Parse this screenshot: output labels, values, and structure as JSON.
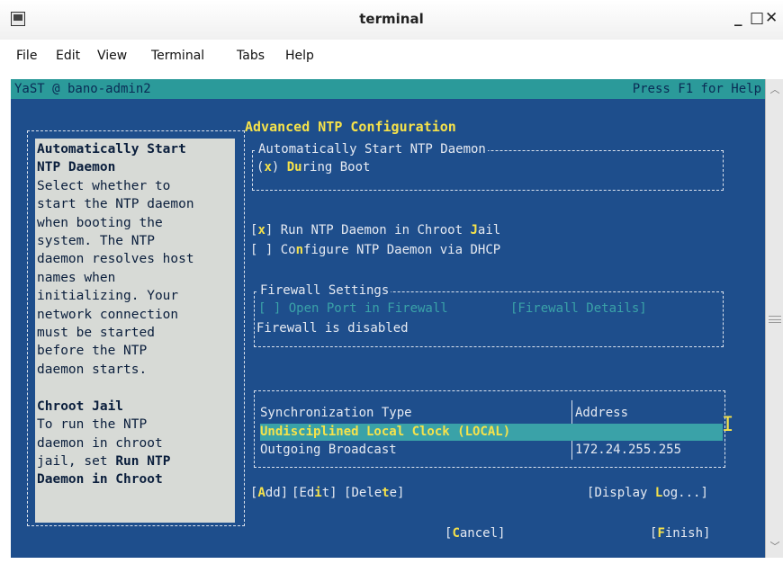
{
  "window": {
    "title": "terminal",
    "min_glyph": "_",
    "max_glyph": "□",
    "close_glyph": "✕"
  },
  "menu": {
    "file": "File",
    "edit": "Edit",
    "view": "View",
    "terminal": "Terminal",
    "tabs": "Tabs",
    "help": "Help"
  },
  "yast": {
    "header_left": "YaST @ bano-admin2",
    "header_right": "Press F1 for Help",
    "help_text": {
      "heading1": "Automatically Start",
      "heading1b": "NTP Daemon",
      "para1": "Select whether to\nstart the NTP daemon\nwhen booting the\nsystem. The NTP\ndaemon resolves host\nnames when\ninitializing. Your\nnetwork connection\nmust be started\nbefore the NTP\ndaemon starts.",
      "heading2": "Chroot Jail",
      "para2a": "To run the NTP\ndaemon in chroot\njail, set ",
      "para2b": "Run NTP",
      "para2c": "Daemon in Chroot"
    },
    "panel_title": "Advanced NTP Configuration",
    "auto_start": {
      "frame_title": "Automatically Start NTP Daemon",
      "radio_mark": "x",
      "radio_label_hot": "Du",
      "radio_label_rest": "ring Boot"
    },
    "chroot": {
      "mark": "x",
      "label_pre": "Run NTP Daemon in Chroot ",
      "label_hot": "J",
      "label_post": "ail"
    },
    "dhcp": {
      "mark": " ",
      "label_pre": "Co",
      "label_hot": "n",
      "label_post": "figure NTP Daemon via DHCP"
    },
    "firewall": {
      "frame_title": "Firewall Settings",
      "open_port_label": "[ ] Open Port in Firewall",
      "details_label": "[Firewall Details]",
      "status": "Firewall is disabled"
    },
    "sync_table": {
      "columns": [
        "Synchronization Type",
        "Address"
      ],
      "rows": [
        [
          "Undisciplined Local Clock (LOCAL)",
          ""
        ],
        [
          "Outgoing Broadcast",
          "172.24.255.255"
        ]
      ]
    },
    "buttons": {
      "add_hot": "A",
      "add_rest": "dd",
      "edit_pre": "Ed",
      "edit_hot": "i",
      "edit_post": "t",
      "delete_pre": "Dele",
      "delete_hot": "t",
      "delete_post": "e",
      "display_log_pre": "Display ",
      "display_log_hot": "L",
      "display_log_post": "og...",
      "cancel_hot": "C",
      "cancel_rest": "ancel",
      "finish_hot": "F",
      "finish_rest": "inish"
    },
    "cursor_glyph": "I"
  },
  "colors": {
    "terminal_bg": "#1e4e8c",
    "header_bg": "#2b9a9a",
    "hotkey": "#f6e24a",
    "selection": "#3aa2a8"
  }
}
